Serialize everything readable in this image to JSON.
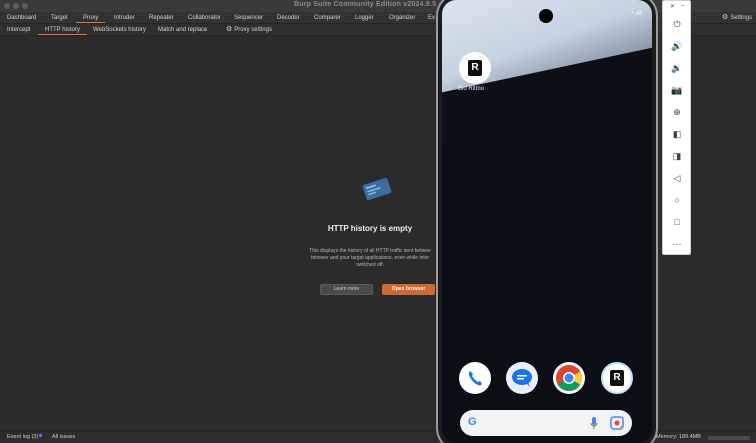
{
  "window": {
    "title": "Burp Suite Community Edition v2024.8.5 - Temp"
  },
  "main_tabs": [
    {
      "label": "Dashboard"
    },
    {
      "label": "Target"
    },
    {
      "label": "Proxy"
    },
    {
      "label": "Intruder"
    },
    {
      "label": "Repeater"
    },
    {
      "label": "Collaborator"
    },
    {
      "label": "Sequencer"
    },
    {
      "label": "Decoder"
    },
    {
      "label": "Comparer"
    },
    {
      "label": "Logger"
    },
    {
      "label": "Organizer"
    },
    {
      "label": "Ex"
    }
  ],
  "settings_label": "Settings",
  "sub_tabs": [
    {
      "label": "Intercept"
    },
    {
      "label": "HTTP history"
    },
    {
      "label": "WebSockets history"
    },
    {
      "label": "Match and replace"
    },
    {
      "label": "Proxy settings"
    }
  ],
  "empty_state": {
    "title": "HTTP history is empty",
    "desc_line1": "This displays the history of all HTTP traffic sent betwee",
    "desc_line2": "browser and your target applications, even while inter",
    "desc_line3": "switched off.",
    "learn_more": "Learn more",
    "open_browser": "Open browser"
  },
  "status_bar": {
    "event_log": "Event log (3)",
    "all_issues": "All issues",
    "memory": "Memory: 189.4MB"
  },
  "phone": {
    "app_label": "Bio Ritmo",
    "app_glyph": "R",
    "dock_glyph": "R",
    "google_glyph": "G"
  },
  "colors": {
    "accent": "#e8743b",
    "open_browser_bg": "#d06a35",
    "background": "#2b2b2b"
  },
  "icons": {
    "emulator_tools": [
      "power-icon",
      "volume-up-icon",
      "volume-down-icon",
      "camera-icon",
      "zoom-in-icon",
      "rotate-left-icon",
      "rotate-right-icon",
      "back-icon",
      "home-icon",
      "overview-icon",
      "more-icon"
    ]
  }
}
